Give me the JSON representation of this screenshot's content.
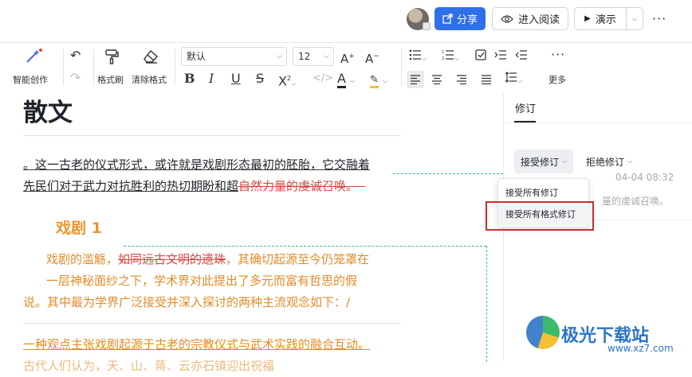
{
  "header": {
    "share_label": "分享",
    "read_label": "进入阅读",
    "present_label": "演示",
    "more_label": "···"
  },
  "toolbar": {
    "smart_create": "智能创作",
    "format_painter": "格式刷",
    "clear_format": "清除格式",
    "font_name": "默认",
    "font_size": "12",
    "more": "更多"
  },
  "doc": {
    "title": "散文",
    "p1_line1_ins": "。这一古老的仪式形式，或许就是戏剧形态最初的胚胎，它交融着",
    "p1_line2_ins": "先民们对于武力对抗胜利的热切期盼和超",
    "p1_line2_del": "自然力量的虔诚召唤。",
    "heading": "戏剧 1",
    "p2_line1_a": "戏剧的滥觞，",
    "p2_line1_del": "如同远古文明的遗珠",
    "p2_line1_b": "，其确切起源至今仍笼罩在",
    "p2_line2": "一层神秘面纱之下，学术界对此提出了多元而富有哲思的假",
    "p2_line3": "说。其中最为学界广泛接受并深入探讨的两种主流观念如下：/",
    "p3_line1": "一种观点主张戏剧起源于古老的宗教仪式与武术实践的融合互动。",
    "p3_line2": "古代人们认为，天、山、蒋、云亦石镇迎出祝福"
  },
  "panel": {
    "tab_label": "修订",
    "accept_label": "接受修订",
    "reject_label": "拒绝修订",
    "timestamp": "04-04 08:32",
    "preview_text": "量的虔诚召唤。",
    "dropdown_items": [
      "接受所有修订",
      "接受所有格式修订"
    ]
  },
  "watermark": {
    "brand": "极光下载站",
    "url": "www.xz7.com"
  },
  "colors": {
    "accent": "#2f6fe8",
    "deleted": "#d64a45",
    "heading": "#e8962f",
    "highlight": "#d42b2b"
  }
}
